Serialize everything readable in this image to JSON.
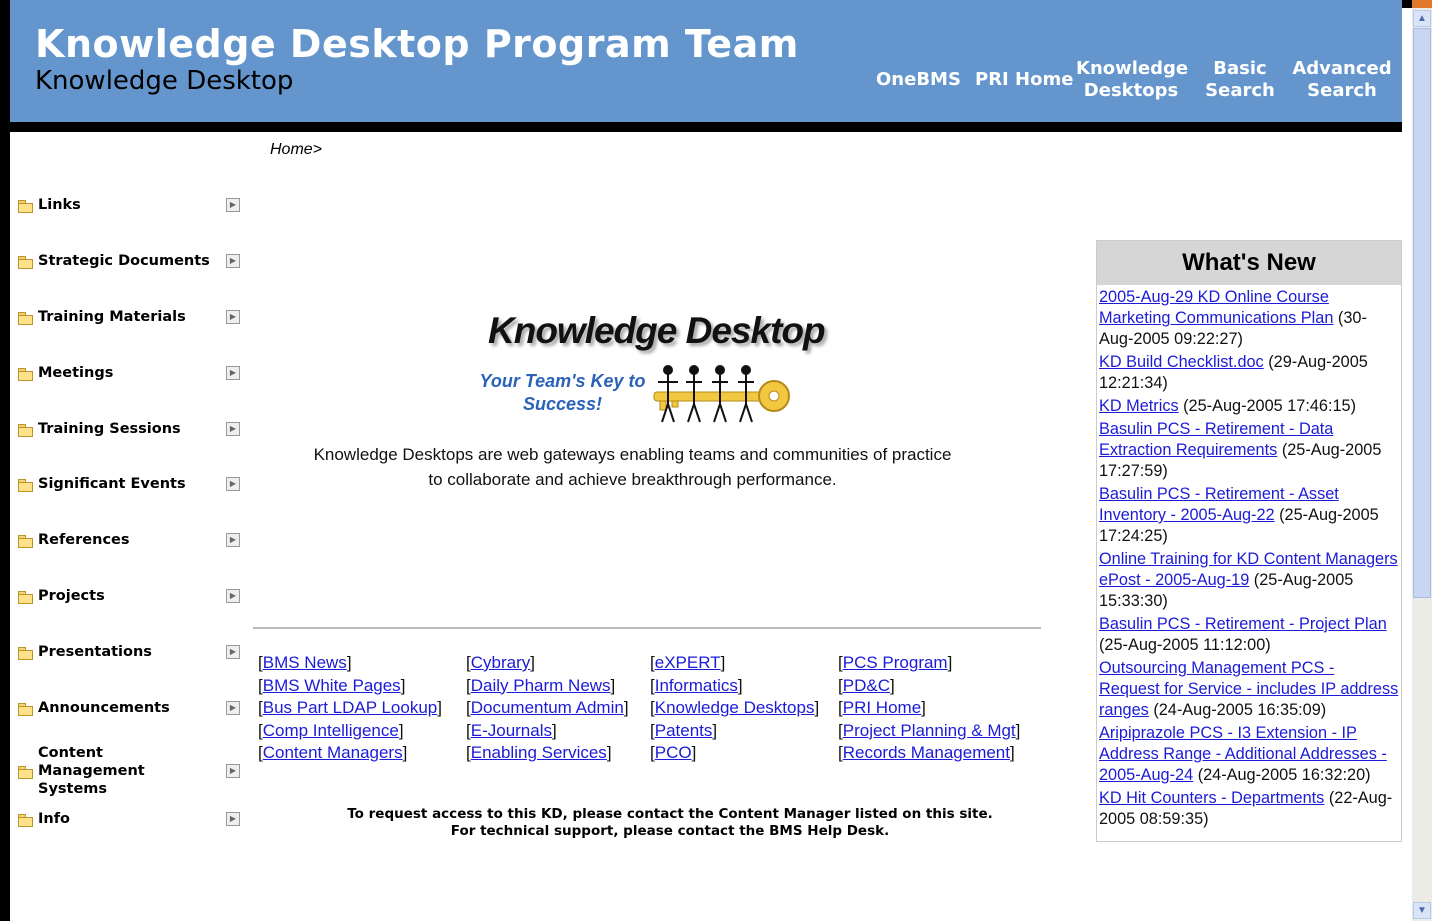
{
  "header": {
    "title": "Knowledge Desktop Program Team",
    "subtitle": "Knowledge Desktop",
    "nav": [
      "OneBMS",
      "PRI Home",
      "Knowledge Desktops",
      "Basic Search",
      "Advanced Search"
    ]
  },
  "breadcrumb": "Home>",
  "sidebar": {
    "items": [
      {
        "label": "Links"
      },
      {
        "label": "Strategic Documents"
      },
      {
        "label": "Training Materials"
      },
      {
        "label": "Meetings"
      },
      {
        "label": "Training Sessions"
      },
      {
        "label": "Significant Events"
      },
      {
        "label": "References"
      },
      {
        "label": "Projects"
      },
      {
        "label": "Presentations"
      },
      {
        "label": "Announcements"
      },
      {
        "label": "Content Management Systems"
      },
      {
        "label": "Info"
      }
    ]
  },
  "logo": {
    "title": "Knowledge Desktop",
    "tagline": "Your Team's Key to Success!"
  },
  "intro": "Knowledge Desktops are web gateways enabling teams and communities of practice to collaborate and achieve breakthrough performance.",
  "links": {
    "col1": [
      "BMS News",
      "BMS White Pages",
      "Bus Part LDAP Lookup",
      "Comp Intelligence",
      "Content Managers"
    ],
    "col2": [
      "Cybrary",
      "Daily Pharm News",
      "Documentum Admin",
      "E-Journals",
      "Enabling Services"
    ],
    "col3": [
      "eXPERT",
      "Informatics",
      "Knowledge Desktops",
      "Patents",
      "PCO"
    ],
    "col4": [
      "PCS Program",
      "PD&C",
      "PRI Home",
      "Project Planning & Mgt",
      "Records Management"
    ]
  },
  "access_note": {
    "line1": "To request access to this KD, please contact the Content Manager listed on this site.",
    "line2": "For technical support, please contact the BMS Help Desk."
  },
  "whats_new": {
    "title": "What's New",
    "entries": [
      {
        "link": "2005-Aug-29 KD Online Course Marketing Communications Plan",
        "date": "(30-Aug-2005 09:22:27)"
      },
      {
        "link": "KD Build Checklist.doc",
        "date": "(29-Aug-2005 12:21:34)"
      },
      {
        "link": "KD Metrics",
        "date": "(25-Aug-2005 17:46:15)"
      },
      {
        "link": "Basulin PCS - Retirement - Data Extraction Requirements",
        "date": "(25-Aug-2005 17:27:59)"
      },
      {
        "link": "Basulin PCS - Retirement - Asset Inventory - 2005-Aug-22",
        "date": "(25-Aug-2005 17:24:25)"
      },
      {
        "link": "Online Training for KD Content Managers ePost - 2005-Aug-19",
        "date": "(25-Aug-2005 15:33:30)"
      },
      {
        "link": "Basulin PCS - Retirement - Project Plan",
        "date": "(25-Aug-2005 11:12:00)"
      },
      {
        "link": "Outsourcing Management PCS - Request for Service - includes IP address ranges",
        "date": "(24-Aug-2005 16:35:09)"
      },
      {
        "link": "Aripiprazole PCS - I3 Extension - IP Address Range - Additional Addresses - 2005-Aug-24",
        "date": "(24-Aug-2005 16:32:20)"
      },
      {
        "link": "KD Hit Counters - Departments",
        "date": "(22-Aug-2005 08:59:35)"
      }
    ]
  },
  "colors": {
    "header_bg": "#6496cd",
    "link": "#1b1bd8",
    "tagline": "#2a62b8",
    "folder": "#fde28a"
  },
  "icons": {
    "folder": "folder-icon",
    "expand": "expand-arrow-icon",
    "scroll_up": "scroll-up-arrow-icon",
    "scroll_down": "scroll-down-arrow-icon"
  }
}
